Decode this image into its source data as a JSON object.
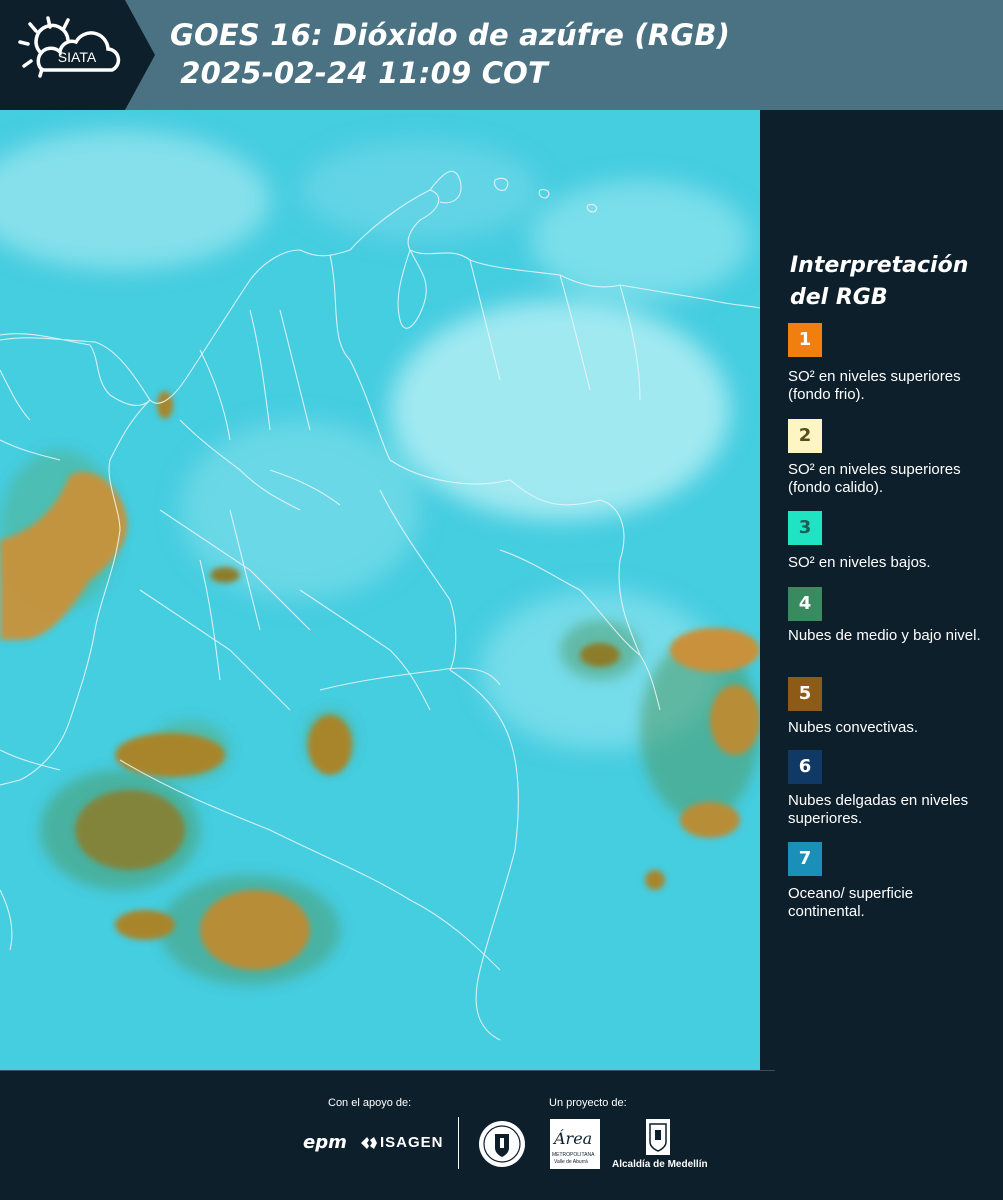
{
  "header": {
    "logo_text": "SIATA",
    "title_line1": "GOES 16: Dióxido de azúfre (RGB)",
    "title_line2": " 2025-02-24 11:09 COT"
  },
  "map": {
    "base_color": "#45cde0",
    "border_color": "#e8f4f8",
    "convective_color": "#a8852a"
  },
  "legend": {
    "title_line1": "Interpretación",
    "title_line2": "del RGB",
    "items": [
      {
        "number": "1",
        "color": "#f07f0f",
        "text_color": "#ffffff",
        "text": "SO² en niveles superiores (fondo frio)."
      },
      {
        "number": "2",
        "color": "#fdf6c2",
        "text_color": "#5a4a20",
        "text": "SO² en niveles superiores (fondo calido)."
      },
      {
        "number": "3",
        "color": "#1fe3c3",
        "text_color": "#1b5e55",
        "text": "SO² en niveles bajos."
      },
      {
        "number": "4",
        "color": "#3a8a5f",
        "text_color": "#ffffff",
        "text": "Nubes de medio y bajo nivel."
      },
      {
        "number": "5",
        "color": "#8d5b16",
        "text_color": "#ffffff",
        "text": "Nubes convectivas."
      },
      {
        "number": "6",
        "color": "#103966",
        "text_color": "#ffffff",
        "text": "Nubes delgadas en niveles superiores."
      },
      {
        "number": "7",
        "color": "#1a8fb8",
        "text_color": "#ffffff",
        "text": "Oceano/ superficie continental."
      }
    ]
  },
  "footer": {
    "support_label": "Con el apoyo de:",
    "project_label": "Un proyecto de:",
    "sponsors": [
      "epm",
      "ISAGEN"
    ],
    "partners": [
      "Área Metropolitana Valle de Aburrá",
      "Alcaldía de Medellín"
    ],
    "area_logo_text": "Área",
    "area_logo_subtext": "METROPOLITANA",
    "area_logo_subtext2": "Valle de Aburrá",
    "alcaldia_text": "Alcaldía de Medellín"
  }
}
